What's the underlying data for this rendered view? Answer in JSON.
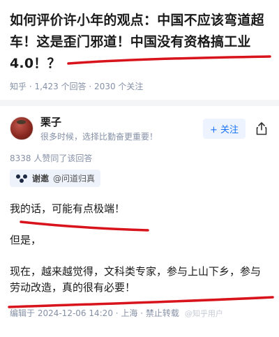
{
  "question": {
    "title": "如何评价许小年的观点：中国不应该弯道超车！这是歪门邪道！中国没有资格搞工业4.0！？",
    "meta": "知乎 · 1,423 个回答 · 2030 个关注"
  },
  "answer": {
    "author": "栗子",
    "bio": "很多时候，选择比勤奋更重要！",
    "follow_label": "+ 关注",
    "upvotes": "8338 人赞同了该回答",
    "invite_label": "谢邀",
    "invite_user": "@问道归真",
    "paragraphs": [
      "我的话，可能有点极端！",
      "但是，",
      "现在，越来越觉得，文科类专家，参与上山下乡，参与劳动改造，真的很有必要！"
    ],
    "edited": "编辑于 2024-12-06 14:20 · 上海 · 禁止转载",
    "watermark": "@知乎用户"
  },
  "colors": {
    "accent": "#1772f6",
    "underline": "#d9131b",
    "meta": "#8590a6"
  },
  "icons": [
    "avatar",
    "share-icon",
    "invite-icon"
  ]
}
